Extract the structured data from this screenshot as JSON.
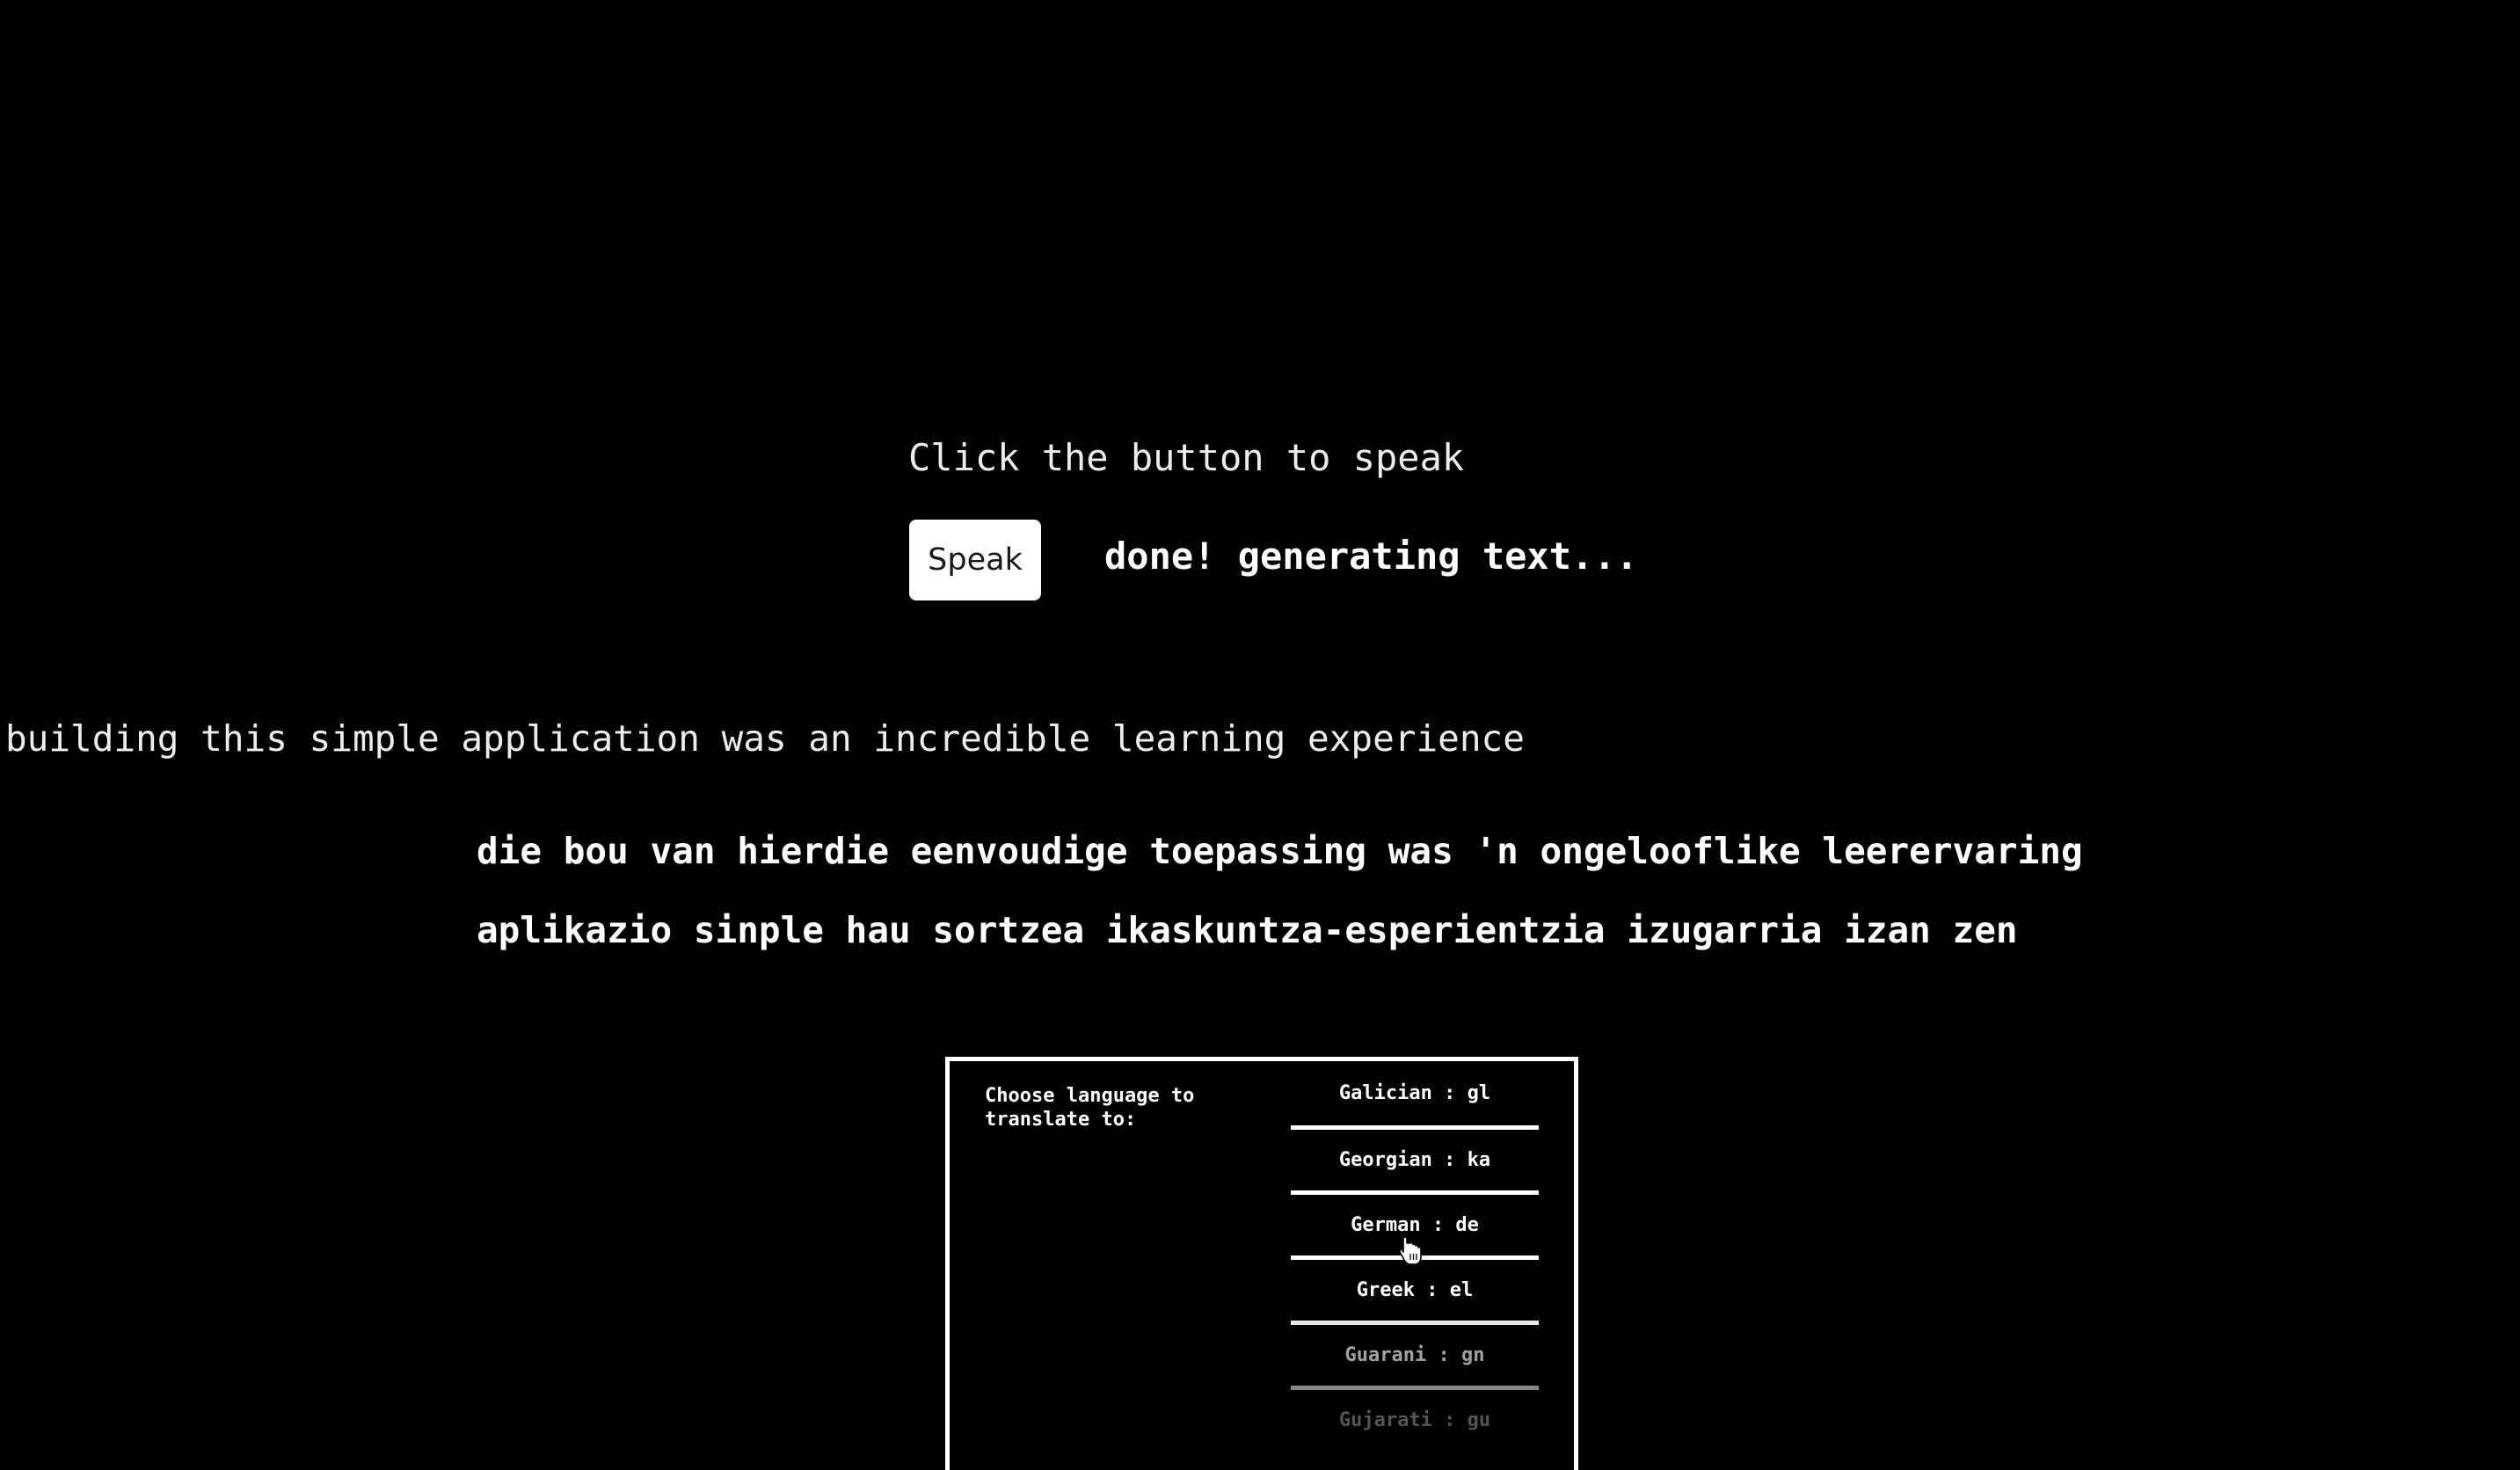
{
  "prompt": "Click the button to speak",
  "speak_button_label": "Speak",
  "status": "done! generating text...",
  "recognized_text": "building this simple application was an incredible learning experience",
  "translations": [
    "die bou van hierdie eenvoudige toepassing was 'n ongelooflike leerervaring",
    "aplikazio sinple hau sortzea ikaskuntza-esperientzia izugarria izan zen"
  ],
  "language_panel": {
    "label": "Choose language to translate to:",
    "languages": [
      "Galician : gl",
      "Georgian : ka",
      "German : de",
      "Greek : el",
      "Guarani : gn",
      "Gujarati : gu"
    ],
    "hovered": "German : de"
  },
  "colors": {
    "background": "#000000",
    "text": "#ffffff",
    "button_background": "#ffffff"
  },
  "icons": {
    "cursor": "hand-pointer-icon"
  }
}
